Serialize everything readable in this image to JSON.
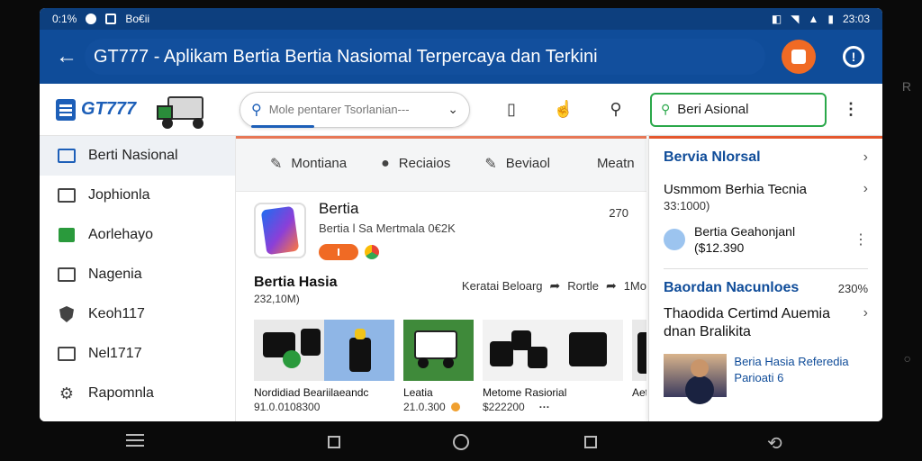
{
  "status_bar": {
    "left_text": "0:1%",
    "carrier": "Bo€ii",
    "time": "23:03"
  },
  "app_bar": {
    "title": "GT777 - Aplikam Bertia Bertia Nasiomal Terpercaya dan Terkini"
  },
  "toolbar": {
    "logo_text": "GT777",
    "search_placeholder": "Mole pentarer Tsorlanian---",
    "green_search_label": "Beri Asional"
  },
  "sidebar": {
    "items": [
      {
        "label": "Berti Nasional",
        "icon": "monitor-icon",
        "active": true
      },
      {
        "label": "Jophionla",
        "icon": "gallery-icon"
      },
      {
        "label": "Aorlehayo",
        "icon": "folder-icon"
      },
      {
        "label": "Nagenia",
        "icon": "card-icon"
      },
      {
        "label": "Keoh117",
        "icon": "shield-icon"
      },
      {
        "label": "Nel1717",
        "icon": "calendar-icon"
      },
      {
        "label": "Rapomnla",
        "icon": "gear-icon"
      }
    ]
  },
  "main": {
    "tabs": [
      {
        "label": "Montiana",
        "icon": "edit-icon"
      },
      {
        "label": "Reciaios",
        "icon": "chat-icon"
      },
      {
        "label": "Beviaol",
        "icon": "pin-icon"
      },
      {
        "label": "Meatn",
        "icon": ""
      }
    ],
    "card": {
      "title": "Bertia",
      "subtitle": "Bertia l Sa Mertmala 0€2K",
      "count": "270"
    },
    "section": {
      "title": "Bertia Hasia",
      "subtitle": "232,10M)",
      "action1": "Keratai Beloarg",
      "action2": "Rortle",
      "action3": "1Mo"
    },
    "thumbs": [
      {
        "label": "Nordidiad Beariilaeandc",
        "sub": "91.0.0108300"
      },
      {
        "label": "Leatia",
        "sub": "21.0.300"
      },
      {
        "label": "Metome Rasiorial",
        "sub": "$222200"
      },
      {
        "label": "Aet",
        "sub": ""
      }
    ]
  },
  "right_panel": {
    "head": "Bervia Nlorsal",
    "row1_title": "Usmmom Berhia Tecnia",
    "row1_sub": "33:1000)",
    "user_name": "Bertia Geahonjanl",
    "user_sub": "($12.390",
    "section_title": "Baordan Nacunloes",
    "section_num": "230%",
    "row2_title": "Thaodida Certimd Auemia dnan Bralikita",
    "news_text": "Beria Hasia Referedia Parioati 6"
  }
}
